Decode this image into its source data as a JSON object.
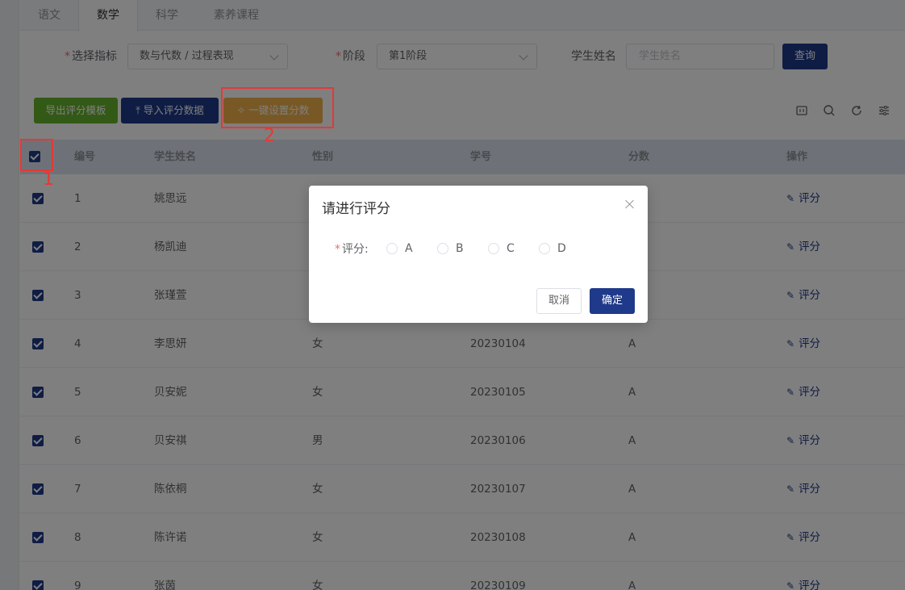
{
  "tabs": [
    "语文",
    "数学",
    "科学",
    "素养课程"
  ],
  "filters": {
    "indicator_label": "选择指标",
    "indicator_value": "数与代数 / 过程表现",
    "stage_label": "阶段",
    "stage_value": "第1阶段",
    "name_label": "学生姓名",
    "name_placeholder": "学生姓名",
    "query_button": "查询",
    "required_mark": "*"
  },
  "toolbar": {
    "export_template": "导出评分模板",
    "import_data": "导入评分数据",
    "one_click_score": "一键设置分数",
    "tools": [
      "grid-icon",
      "search-icon",
      "refresh-icon",
      "filter-icon"
    ]
  },
  "table": {
    "headers": [
      "编号",
      "学生姓名",
      "性别",
      "学号",
      "分数",
      "操作"
    ],
    "rows": [
      {
        "no": "1",
        "name": "姚思远",
        "gender": "",
        "id": "",
        "score": "",
        "op": "评分"
      },
      {
        "no": "2",
        "name": "杨凯迪",
        "gender": "",
        "id": "",
        "score": "",
        "op": "评分"
      },
      {
        "no": "3",
        "name": "张瑾萱",
        "gender": "",
        "id": "",
        "score": "",
        "op": "评分"
      },
      {
        "no": "4",
        "name": "李思妍",
        "gender": "女",
        "id": "20230104",
        "score": "A",
        "op": "评分"
      },
      {
        "no": "5",
        "name": "贝安妮",
        "gender": "女",
        "id": "20230105",
        "score": "A",
        "op": "评分"
      },
      {
        "no": "6",
        "name": "贝安祺",
        "gender": "男",
        "id": "20230106",
        "score": "A",
        "op": "评分"
      },
      {
        "no": "7",
        "name": "陈依桐",
        "gender": "女",
        "id": "20230107",
        "score": "A",
        "op": "评分"
      },
      {
        "no": "8",
        "name": "陈许诺",
        "gender": "女",
        "id": "20230108",
        "score": "A",
        "op": "评分"
      },
      {
        "no": "9",
        "name": "张茵",
        "gender": "女",
        "id": "20230109",
        "score": "A",
        "op": "评分"
      }
    ]
  },
  "dialog": {
    "title": "请进行评分",
    "label": "评分:",
    "options": [
      "A",
      "B",
      "C",
      "D"
    ],
    "cancel": "取消",
    "confirm": "确定"
  },
  "annotations": [
    "1",
    "2"
  ],
  "colors": {
    "primary": "#1f3a8a",
    "green": "#67b32c",
    "orange": "#f0b24d",
    "annotation": "#e53935"
  }
}
